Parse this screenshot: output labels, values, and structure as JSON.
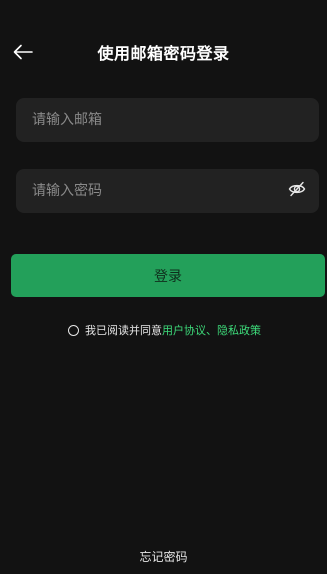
{
  "header": {
    "back_icon": "arrow-left-icon",
    "title": "使用邮箱密码登录"
  },
  "form": {
    "email_placeholder": "请输入邮箱",
    "email_value": "",
    "password_placeholder": "请输入密码",
    "password_value": "",
    "password_toggle_icon": "eye-off-icon",
    "login_label": "登录"
  },
  "agreement": {
    "checked": false,
    "prefix": "我已阅读并同意",
    "user_agreement": "用户协议",
    "separator": "、",
    "privacy_policy": "隐私政策"
  },
  "footer": {
    "forgot_password": "忘记密码"
  },
  "colors": {
    "background": "#121212",
    "field_background": "#222222",
    "accent": "#23a05a",
    "link": "#3ddb7a"
  }
}
